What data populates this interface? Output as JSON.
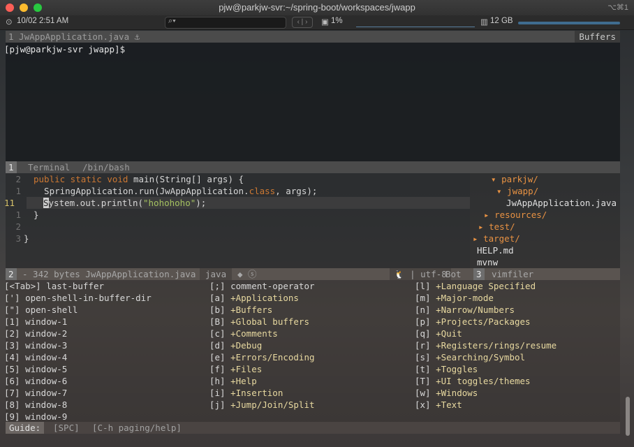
{
  "window": {
    "title": "pjw@parkjw-svr:~/spring-boot/workspaces/jwapp",
    "shortcut": "⌥⌘1"
  },
  "status": {
    "datetime": "10/02 2:51 AM",
    "cpu": "1%",
    "memory": "12 GB"
  },
  "terminal": {
    "header_left": "1 JwAppApplication.java ⚓",
    "header_right": "Buffers",
    "prompt": "[pjw@parkjw-svr jwapp]$",
    "footer_num": "1",
    "footer_name": "Terminal",
    "footer_shell": "/bin/bash"
  },
  "editor": {
    "lines": [
      {
        "num": "2",
        "parts": [
          [
            "kw",
            "public static void "
          ],
          [
            "",
            "main(String[] args) {"
          ]
        ]
      },
      {
        "num": "1",
        "parts": [
          [
            "",
            "  SpringApplication.run(JwAppApplication."
          ],
          [
            "kw",
            "class"
          ],
          [
            "",
            ", args);"
          ]
        ]
      },
      {
        "num": "11",
        "current": true,
        "parts": [
          [
            "cur",
            "S"
          ],
          [
            "",
            "ystem.out.println("
          ],
          [
            "str",
            "\"hohohoho\""
          ],
          [
            "",
            ");"
          ]
        ]
      },
      {
        "num": "1",
        "parts": [
          [
            "",
            "}"
          ]
        ]
      },
      {
        "num": "2",
        "parts": [
          [
            "",
            ""
          ]
        ]
      },
      {
        "num": "3",
        "parts": [
          [
            "",
            "}"
          ]
        ]
      }
    ]
  },
  "tree": {
    "items": [
      {
        "arrow": "▾",
        "label": "parkjw/",
        "dir": true
      },
      {
        "arrow": "▾",
        "label": "jwapp/",
        "dir": true
      },
      {
        "arrow": "",
        "label": "JwAppApplication.java",
        "dir": false
      },
      {
        "arrow": "▸",
        "label": "resources/",
        "dir": true
      },
      {
        "arrow": "▸",
        "label": "test/",
        "dir": true
      },
      {
        "arrow": "▸",
        "label": "target/",
        "dir": true
      },
      {
        "arrow": "",
        "label": "HELP.md",
        "dir": false
      },
      {
        "arrow": "",
        "label": "mvnw",
        "dir": false
      }
    ]
  },
  "modeline": {
    "window_num": "2",
    "file_info": "- 342 bytes JwAppApplication.java",
    "mode": "java",
    "icons": "◆ ⓢ",
    "os_encoding": "🐧 | utf-8",
    "position": "Bot",
    "vimfiler_num": "3",
    "vimfiler": "vimfiler"
  },
  "guide": {
    "col1": [
      "[<Tab>] last-buffer",
      "['] open-shell-in-buffer-dir",
      "[\"] open-shell",
      "[1] window-1",
      "[2] window-2",
      "[3] window-3",
      "[4] window-4",
      "[5] window-5",
      "[6] window-6",
      "[7] window-7",
      "[8] window-8",
      "[9] window-9"
    ],
    "col2": [
      "[;] comment-operator",
      "[a] +Applications",
      "[b] +Buffers",
      "[B] +Global buffers",
      "[c] +Comments",
      "[d] +Debug",
      "[e] +Errors/Encoding",
      "[f] +Files",
      "[h] +Help",
      "[i] +Insertion",
      "[j] +Jump/Join/Split"
    ],
    "col3": [
      "[l] +Language Specified",
      "[m] +Major-mode",
      "[n] +Narrow/Numbers",
      "[p] +Projects/Packages",
      "[q] +Quit",
      "[r] +Registers/rings/resume",
      "[s] +Searching/Symbol",
      "[t] +Toggles",
      "[T] +UI toggles/themes",
      "[w] +Windows",
      "[x] +Text"
    ]
  },
  "guide_bar": {
    "label": "Guide:",
    "key": "[SPC]",
    "hint": "[C-h paging/help]"
  }
}
